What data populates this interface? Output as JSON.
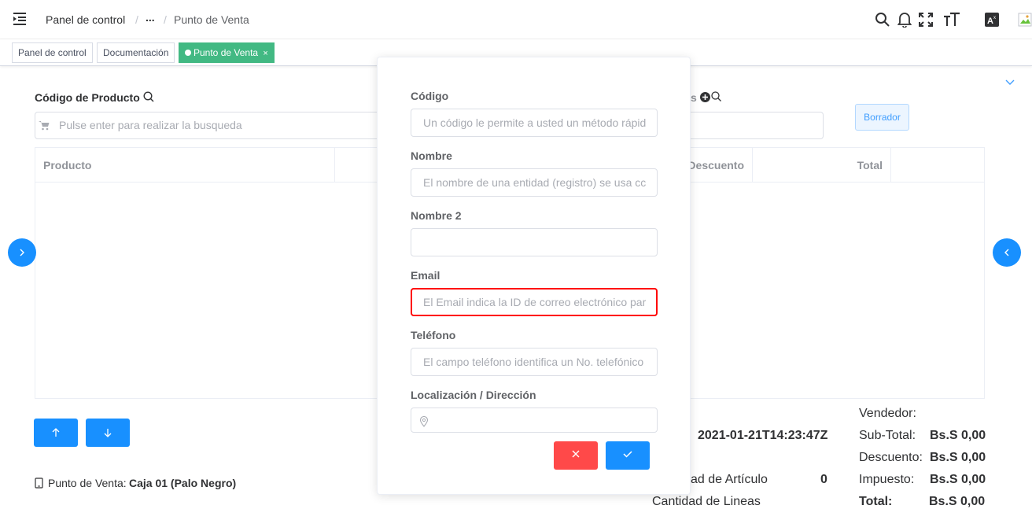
{
  "header": {
    "breadcrumb": [
      "Panel de control",
      "...",
      "Punto de Venta"
    ],
    "separator": "/",
    "icons": [
      "search-icon",
      "bell-icon",
      "fullscreen-icon",
      "font-size-icon",
      "translate-icon",
      "avatar-image"
    ]
  },
  "tags": [
    {
      "label": "Panel de control",
      "active": false
    },
    {
      "label": "Documentación",
      "active": false
    },
    {
      "label": "Punto de Venta",
      "active": true,
      "close": "×"
    }
  ],
  "pos": {
    "product_code_label": "Código de Producto",
    "search_placeholder": "Pulse enter para realizar la busqueda",
    "partial_label": "s",
    "borrador_label": "Borrador",
    "columns": [
      "Producto",
      "Descuento",
      "Total"
    ],
    "date": "2021-01-21T14:23:47Z",
    "pos_label": "Punto de Venta:",
    "pos_value": "Caja 01 (Palo Negro)",
    "qty_articles_label": "ad de Artículo",
    "qty_articles_value": "0",
    "qty_lines_label": "Cantidad de Lineas",
    "vendedor_label": "Vendedor:",
    "subtotal_label": "Sub-Total:",
    "subtotal_value": "Bs.S 0,00",
    "descuento_label": "Descuento:",
    "descuento_value": "Bs.S 0,00",
    "impuesto_label": "Impuesto:",
    "impuesto_value": "Bs.S 0,00",
    "total_label": "Total:",
    "total_value": "Bs.S 0,00"
  },
  "modal": {
    "codigo_label": "Código",
    "codigo_placeholder": "Un código le permite a usted un método rápid",
    "nombre_label": "Nombre",
    "nombre_placeholder": "El nombre de una entidad (registro) se usa cc",
    "nombre2_label": "Nombre 2",
    "nombre2_placeholder": "",
    "email_label": "Email",
    "email_placeholder": "El Email indica la ID de correo electrónico par",
    "telefono_label": "Teléfono",
    "telefono_placeholder": "El campo teléfono identifica un No. telefónico",
    "direccion_label": "Localización / Dirección",
    "cancel_icon": "close-icon",
    "confirm_icon": "check-icon"
  },
  "colors": {
    "primary": "#1890ff",
    "tag_active": "#42b983",
    "danger": "#ff4949",
    "error_border": "#ff0000"
  }
}
